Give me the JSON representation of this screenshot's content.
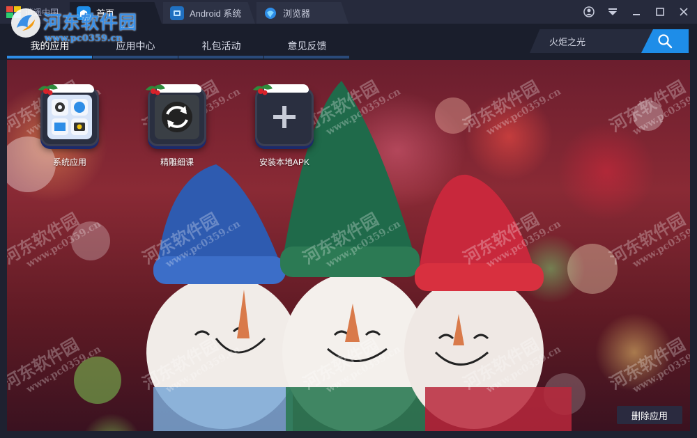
{
  "titlebar": {
    "app_name": "逍遥中国",
    "tabs": [
      {
        "label": "首页",
        "icon": "home-icon",
        "active": true
      },
      {
        "label": "Android 系统",
        "icon": "android-icon",
        "active": false
      },
      {
        "label": "浏览器",
        "icon": "browser-icon",
        "active": false
      }
    ]
  },
  "watermark": {
    "title": "河东软件园",
    "url": "www.pc0359.cn"
  },
  "navbar": {
    "tabs": [
      {
        "label": "我的应用",
        "active": true
      },
      {
        "label": "应用中心",
        "active": false
      },
      {
        "label": "礼包活动",
        "active": false
      },
      {
        "label": "意见反馈",
        "active": false
      }
    ]
  },
  "search": {
    "value": "火炬之光",
    "button_icon": "search-icon"
  },
  "apps": [
    {
      "label": "系统应用",
      "icon": "system-apps-icon"
    },
    {
      "label": "精雕细课",
      "icon": "refresh-app-icon"
    },
    {
      "label": "安装本地APK",
      "icon": "plus-icon"
    }
  ],
  "footer": {
    "delete_label": "删除应用"
  },
  "colors": {
    "accent": "#2e8de6",
    "titlebar": "#262a3c",
    "navbar": "#1a1e2c"
  }
}
